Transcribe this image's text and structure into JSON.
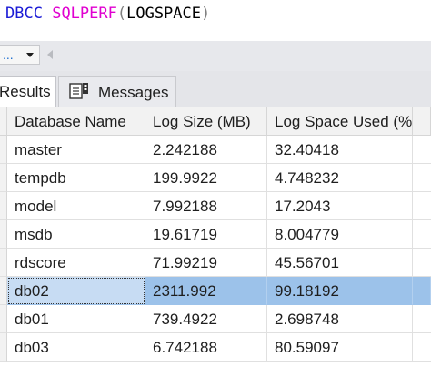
{
  "editor": {
    "keyword": "DBCC",
    "function_name": "SQLPERF",
    "open_paren": "(",
    "argument": "LOGSPACE",
    "close_paren": ")"
  },
  "toolbar": {
    "zoom_value": "..."
  },
  "tabs": [
    {
      "label": "Results",
      "selected": true
    },
    {
      "label": "Messages",
      "selected": false,
      "icon": "messages-icon"
    }
  ],
  "grid": {
    "columns": [
      "Database Name",
      "Log Size (MB)",
      "Log Space Used (%)"
    ],
    "rows": [
      [
        "master",
        "2.242188",
        "32.40418"
      ],
      [
        "tempdb",
        "199.9922",
        "4.748232"
      ],
      [
        "model",
        "7.992188",
        "17.2043"
      ],
      [
        "msdb",
        "19.61719",
        "8.004779"
      ],
      [
        "rdscore",
        "71.99219",
        "45.56701"
      ],
      [
        "db02",
        "2311.992",
        "99.18192"
      ],
      [
        "db01",
        "739.4922",
        "2.698748"
      ],
      [
        "db03",
        "6.742188",
        "80.59097"
      ]
    ],
    "selected_row_index": 5
  },
  "colors": {
    "keyword": "#1b1bd6",
    "function": "#e000d0",
    "selection": "#9cc2ea"
  }
}
